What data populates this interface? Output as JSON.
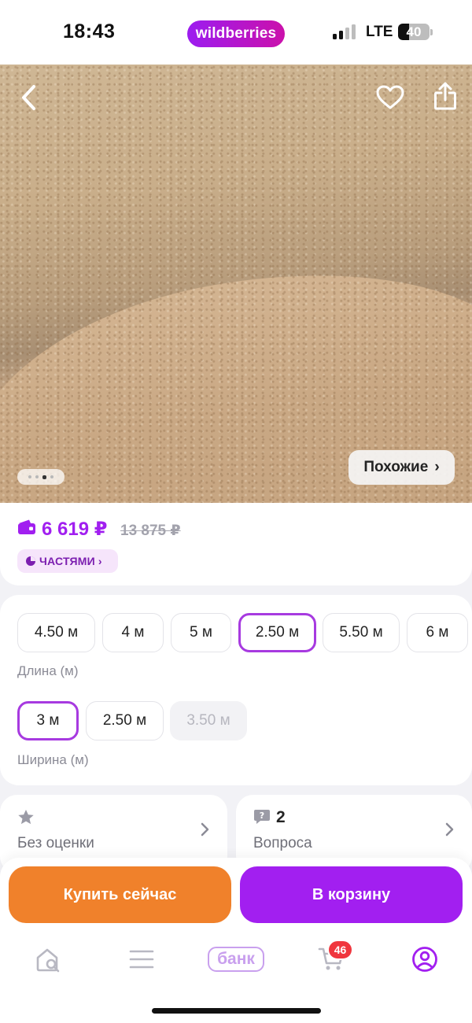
{
  "status_bar": {
    "time": "18:43",
    "app_logo": "wildberries",
    "network": "LTE",
    "battery": "40",
    "battery_level": 0.4
  },
  "product_photo": {
    "icons": [
      "chevron-left-icon",
      "heart-icon",
      "share-icon"
    ],
    "gallery_dots": 4,
    "gallery_active_dot": 3,
    "similar_label": "Похожие",
    "similar_chevron": "›"
  },
  "price": {
    "current": "6 619 ₽",
    "old": "13 875 ₽",
    "installments_label": "ЧАСТЯМИ",
    "installments_chevron": "›",
    "accent_color": "#a11ff0"
  },
  "options": {
    "length": {
      "caption": "Длина (м)",
      "values": [
        "4.50 м",
        "4 м",
        "5 м",
        "2.50 м",
        "5.50 м",
        "6 м"
      ],
      "selected": "2.50 м"
    },
    "width": {
      "caption": "Ширина (м)",
      "values": [
        "3 м",
        "2.50 м",
        "3.50 м"
      ],
      "selected": "3 м",
      "disabled": "3.50 м"
    }
  },
  "info": {
    "rating": {
      "label": "Без оценки"
    },
    "questions": {
      "count": "2",
      "label": "Вопроса"
    }
  },
  "actions": {
    "buy_now": "Купить сейчас",
    "add_to_cart": "В корзину",
    "buy_now_color": "#f0812b",
    "cart_color": "#a21ff0"
  },
  "tab_bar": {
    "bank_label": "банк",
    "cart_badge": "46",
    "icons": [
      "home-search-icon",
      "catalog-menu-icon",
      "bank-logo",
      "cart-icon",
      "profile-icon"
    ],
    "active": "profile-icon"
  }
}
